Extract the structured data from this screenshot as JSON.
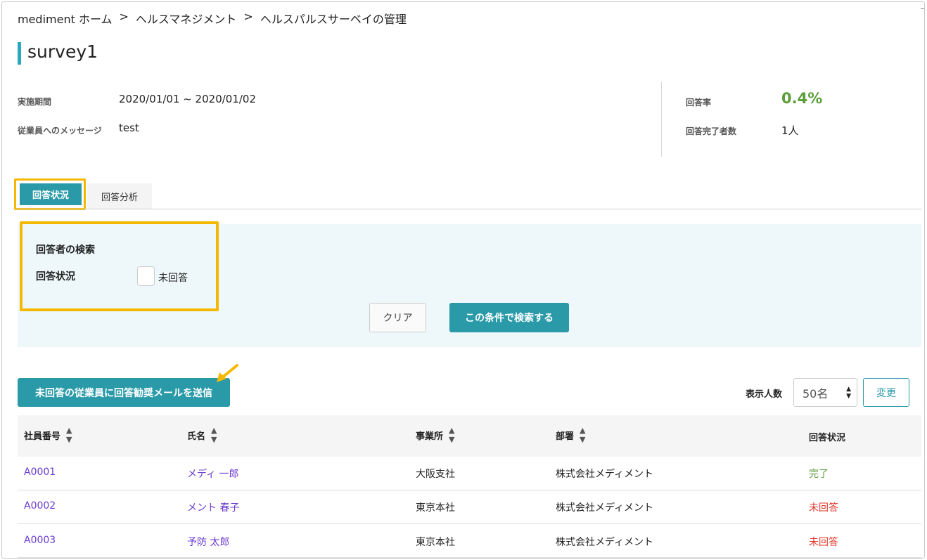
{
  "breadcrumb": {
    "items": [
      "mediment ホーム",
      "ヘルスマネジメント",
      "ヘルスパルスサーベイの管理"
    ],
    "separator": ">"
  },
  "page": {
    "title": "survey1"
  },
  "summary": {
    "period_label": "実施期間",
    "period_value": "2020/01/01 ~ 2020/01/02",
    "message_label": "従業員へのメッセージ",
    "message_value": "test",
    "rate_label": "回答率",
    "rate_value": "0.4%",
    "completed_label": "回答完了者数",
    "completed_value": "1人"
  },
  "tabs": [
    {
      "label": "回答状況",
      "active": true
    },
    {
      "label": "回答分析",
      "active": false
    }
  ],
  "search": {
    "heading": "回答者の検索",
    "status_label": "回答状況",
    "checkbox_label": "未回答",
    "checkbox_checked": false,
    "clear_label": "クリア",
    "submit_label": "この条件で検索する"
  },
  "actions": {
    "mail_button": "未回答の従業員に回答勧奨メールを送信",
    "count_label": "表示人数",
    "count_value": "50名",
    "change_button": "変更"
  },
  "table": {
    "headers": [
      "社員番号",
      "氏名",
      "事業所",
      "部署",
      "回答状況"
    ],
    "rows": [
      {
        "id": "A0001",
        "name": "メディ 一郎",
        "office": "大阪支社",
        "dept": "株式会社メディメント",
        "status": "完了"
      },
      {
        "id": "A0002",
        "name": "メント 春子",
        "office": "東京本社",
        "dept": "株式会社メディメント",
        "status": "未回答"
      },
      {
        "id": "A0003",
        "name": "予防 太郎",
        "office": "東京本社",
        "dept": "株式会社メディメント",
        "status": "未回答"
      }
    ]
  },
  "colors": {
    "accent": "#2a9aa8",
    "highlight": "#f5b800",
    "link": "#6a3bd0",
    "done": "#5a9e3a",
    "pending": "#e0382b"
  },
  "icons": {
    "sort": "sort-arrows-icon",
    "annotation": "arrow-annotation-icon"
  }
}
